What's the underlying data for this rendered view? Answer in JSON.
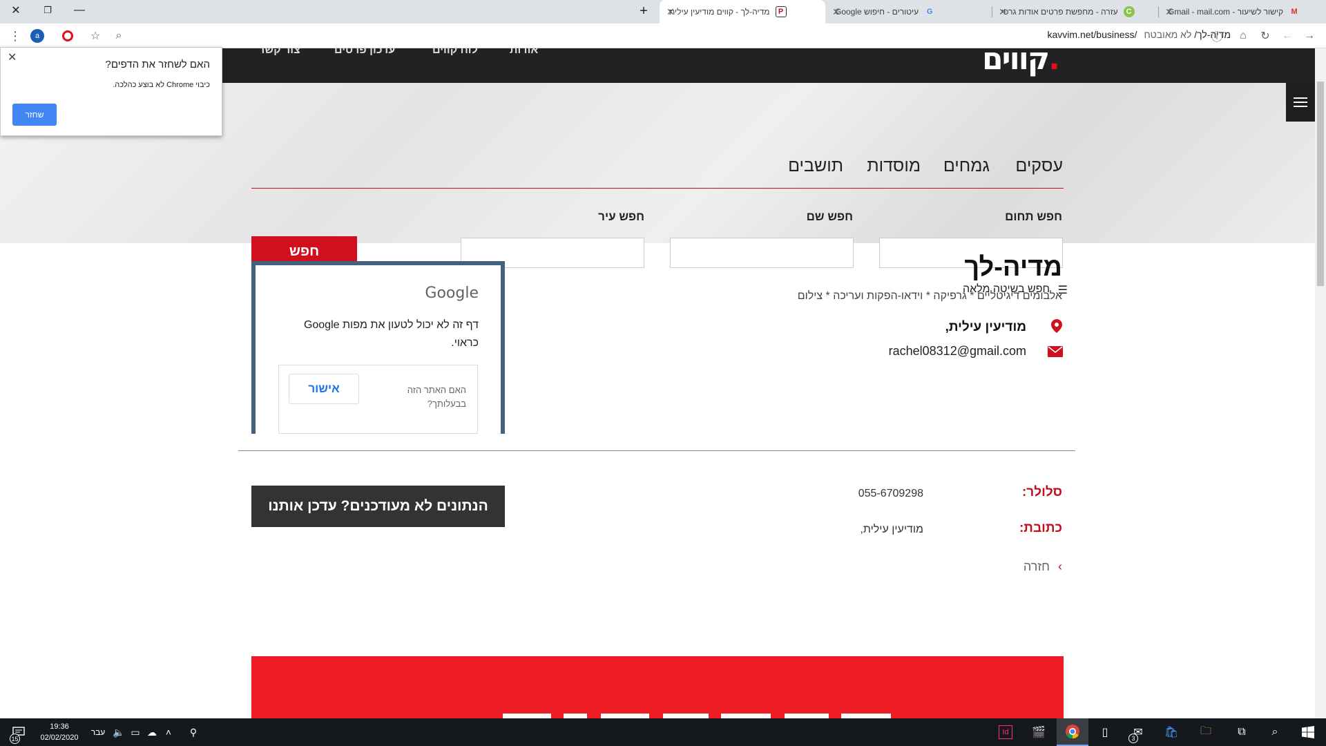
{
  "browser": {
    "tabs": [
      {
        "title": "קישור לשיעור - Gmail - mail.com",
        "favicon": "M"
      },
      {
        "title": "עזרה - מחפשת פרטים אודות גרפי",
        "favicon": "C"
      },
      {
        "title": "עיטורים - חיפוש Google",
        "favicon": "G"
      },
      {
        "title": "מדיה-לך - קווים מודיעין עילית",
        "favicon": "P"
      }
    ],
    "new_tab": "+",
    "url": "kavvim.net/business/מדיה-לך/",
    "not_secure": "לא מאובטח",
    "profile_initial": "a"
  },
  "site": {
    "logo": "קווים",
    "topnav": [
      "אודות",
      "לוח קווים",
      "עדכון פרטים",
      "צור קשר"
    ],
    "categories": [
      "עסקים",
      "גמחים",
      "מוסדות",
      "תושבים"
    ],
    "search": {
      "field_labels": [
        "חפש תחום",
        "חפש שם",
        "חפש עיר"
      ],
      "button": "חפש",
      "advanced": "חפש בשיטה מלאה"
    }
  },
  "business": {
    "name": "מדיה-לך",
    "categories": "אלבומים דיגיטליים  *  גרפיקה  *  וידאו-הפקות ועריכה  *  צילום",
    "location": "מודיעין עילית,",
    "email": "rachel08312@gmail.com",
    "phone_label": "סלולר:",
    "phone": "055-6709298",
    "address_label": "כתובת:",
    "address": "מודיעין עילית,",
    "update_button": "הנתונים לא מעודכנים? עדכן אותנו",
    "back": "חזרה"
  },
  "map": {
    "google": "Google",
    "message": "דף זה לא יכול לטעון את מפות Google כראוי.",
    "own_question": "האם האתר הזה בבעלותך?",
    "own_button": "אישור"
  },
  "popup": {
    "title": "האם לשחזר את הדפים?",
    "subtitle": "כיבוי Chrome לא בוצע כהלכה.",
    "button": "שחזר"
  },
  "taskbar": {
    "time": "19:36",
    "date": "02/02/2020",
    "language": "עבר",
    "notifications": "15",
    "mail_badge": "3"
  }
}
